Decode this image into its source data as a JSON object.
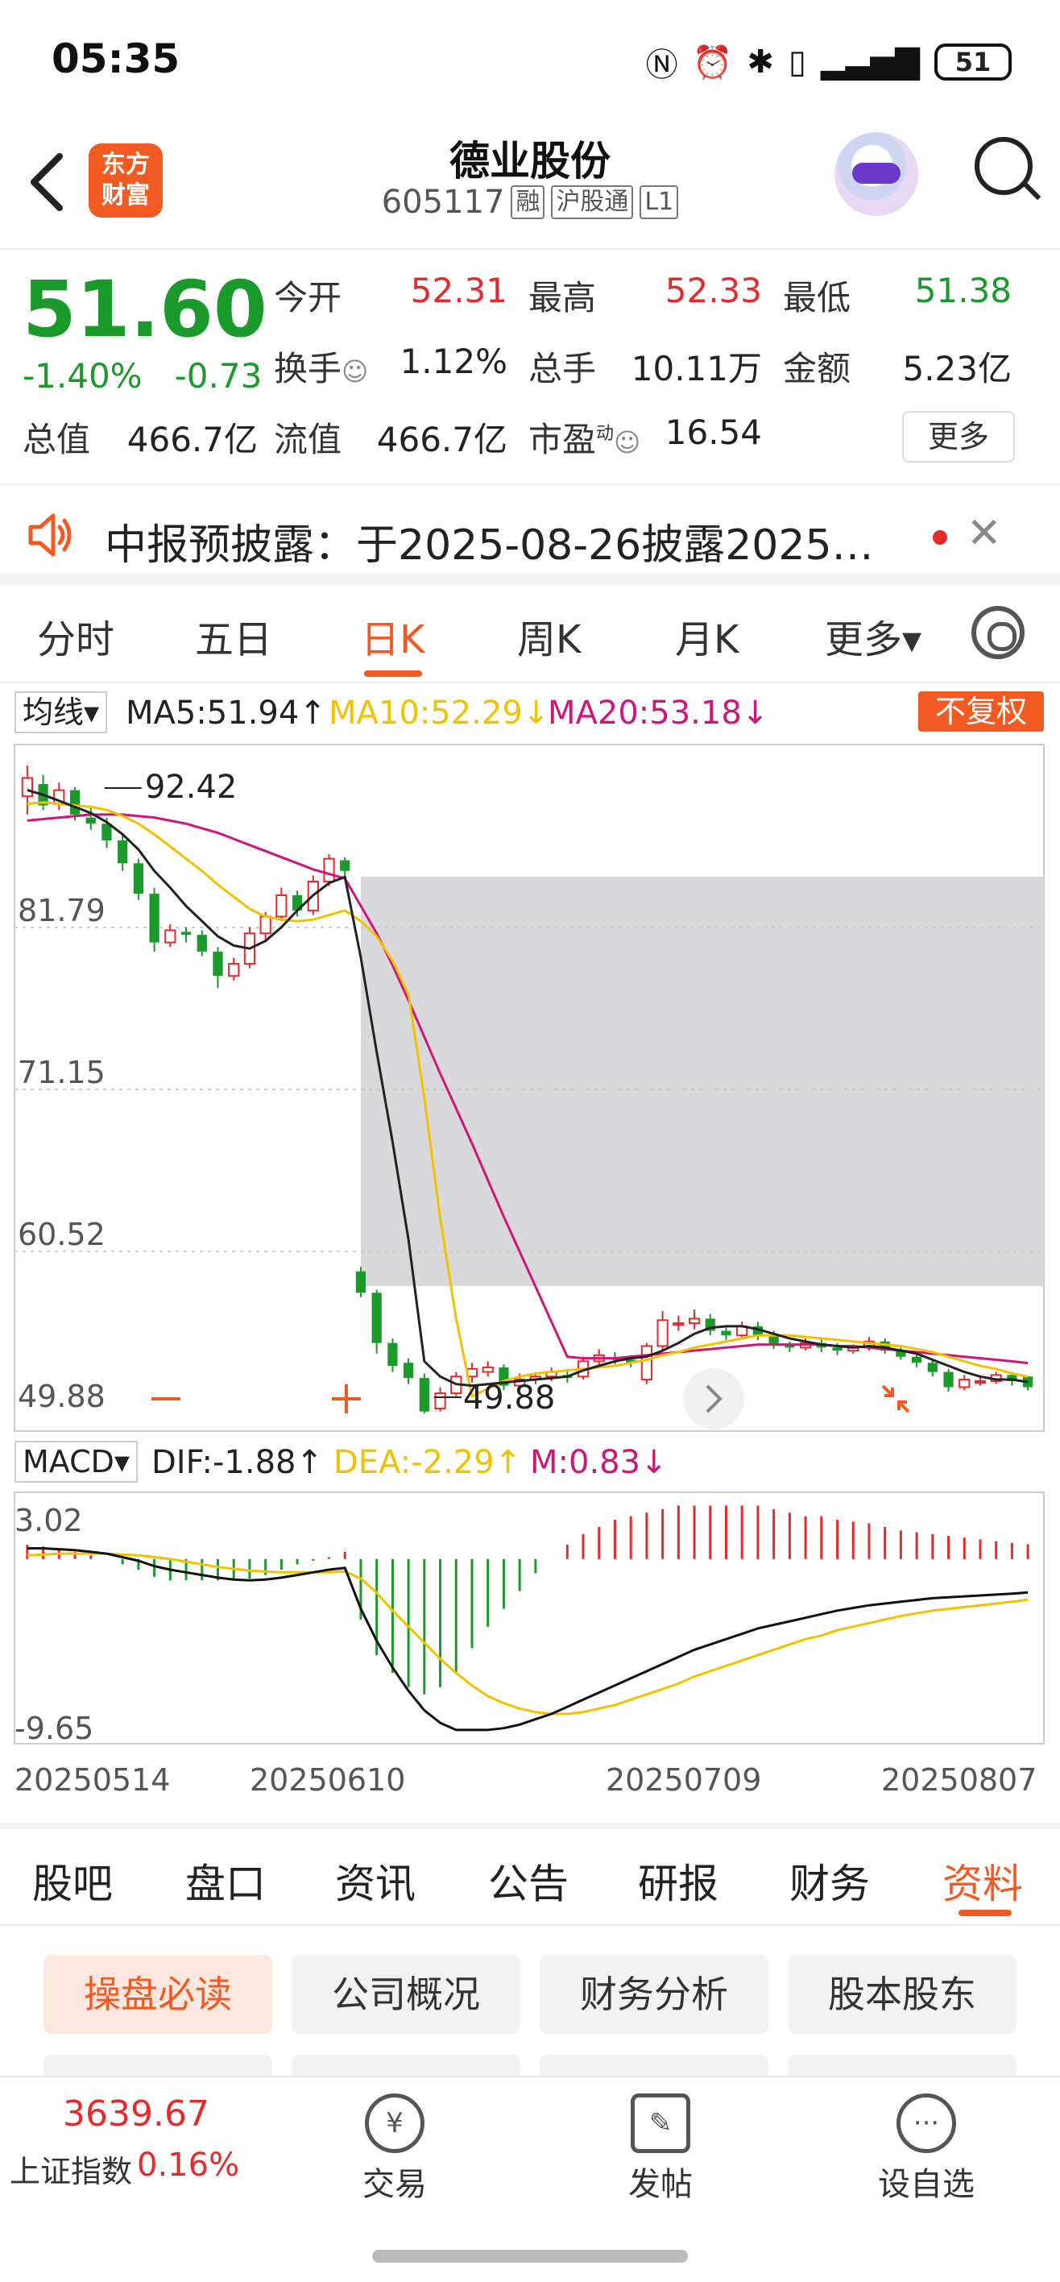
{
  "status_bar": {
    "time": "05:35",
    "battery": "51"
  },
  "header": {
    "back_icon": "chevron-left-icon",
    "logo_text": [
      "东方",
      "财富"
    ],
    "stock_name": "德业股份",
    "stock_code": "605117",
    "tags": [
      "融",
      "沪股通",
      "L1"
    ]
  },
  "quote": {
    "price": "51.60",
    "change_pct": "-1.40%",
    "change_abs": "-0.73",
    "open_label": "今开",
    "open": "52.31",
    "high_label": "最高",
    "high": "52.33",
    "low_label": "最低",
    "low": "51.38",
    "turnover_label": "换手",
    "turnover": "1.12%",
    "volume_label": "总手",
    "volume": "10.11万",
    "amount_label": "金额",
    "amount": "5.23亿",
    "mktcap_label": "总值",
    "mktcap": "466.7亿",
    "float_label": "流值",
    "float": "466.7亿",
    "pe_label": "市盈",
    "pe_sup": "动",
    "pe": "16.54",
    "more_button": "更多",
    "colors": {
      "up": "#e42a2a",
      "down": "#1a9a2a"
    }
  },
  "notice": {
    "text": "中报预披露：于2025-08-26披露2025…"
  },
  "chart_tabs": [
    "分时",
    "五日",
    "日K",
    "周K",
    "月K",
    "更多▾"
  ],
  "ma_row": {
    "select": "均线▾",
    "ma5": "MA5:51.94↑",
    "ma10": "MA10:52.29↓",
    "ma20": "MA20:53.18↓",
    "fq_button": "不复权"
  },
  "macd_row": {
    "select": "MACD▾",
    "dif": "DIF:-1.88↑",
    "dea": "DEA:-2.29↑",
    "m": "M:0.83↓"
  },
  "chart_data": [
    {
      "type": "candlestick",
      "y_axis_labels": [
        "81.79",
        "71.15",
        "60.52",
        "49.88"
      ],
      "ylim": [
        49.88,
        92.42
      ],
      "max_marker": "92.42",
      "min_marker": "49.88",
      "candles": [
        [
          90.4,
          91.6,
          89.2,
          92.42
        ],
        [
          91.2,
          89.8,
          89.5,
          91.8
        ],
        [
          89.9,
          90.8,
          89.5,
          91.3
        ],
        [
          90.8,
          89.2,
          88.8,
          91.0
        ],
        [
          89.0,
          88.6,
          88.2,
          89.8
        ],
        [
          88.6,
          87.5,
          87.0,
          89.0
        ],
        [
          87.5,
          86.0,
          85.5,
          88.0
        ],
        [
          86.0,
          84.0,
          83.6,
          86.3
        ],
        [
          84.0,
          80.8,
          80.2,
          84.4
        ],
        [
          80.8,
          81.6,
          80.5,
          82.0
        ],
        [
          81.5,
          81.3,
          80.8,
          81.8
        ],
        [
          81.3,
          80.2,
          79.9,
          81.6
        ],
        [
          80.2,
          78.6,
          77.8,
          80.5
        ],
        [
          78.6,
          79.4,
          78.3,
          79.8
        ],
        [
          79.4,
          81.4,
          79.1,
          81.8
        ],
        [
          81.4,
          82.5,
          81.0,
          82.8
        ],
        [
          82.5,
          83.9,
          82.2,
          84.4
        ],
        [
          83.9,
          82.9,
          82.5,
          84.2
        ],
        [
          82.9,
          84.8,
          82.6,
          85.2
        ],
        [
          84.8,
          86.3,
          84.5,
          86.6
        ],
        [
          86.2,
          85.5,
          85.0,
          86.4
        ],
        [
          59.2,
          57.8,
          57.5,
          59.5
        ],
        [
          57.8,
          54.5,
          53.8,
          58.0
        ],
        [
          54.5,
          53.0,
          52.6,
          54.8
        ],
        [
          53.2,
          52.2,
          51.8,
          53.5
        ],
        [
          52.2,
          50.0,
          49.88,
          52.5
        ],
        [
          50.2,
          51.2,
          50.0,
          51.6
        ],
        [
          51.2,
          52.3,
          51.0,
          52.6
        ],
        [
          52.3,
          52.8,
          51.9,
          53.2
        ],
        [
          52.6,
          52.9,
          52.3,
          53.3
        ],
        [
          52.9,
          51.7,
          51.4,
          53.1
        ],
        [
          51.7,
          52.1,
          51.5,
          52.5
        ],
        [
          52.1,
          52.3,
          51.8,
          52.6
        ],
        [
          52.3,
          52.6,
          52.0,
          52.9
        ],
        [
          52.4,
          52.2,
          51.9,
          52.8
        ],
        [
          52.3,
          53.3,
          52.1,
          53.6
        ],
        [
          53.3,
          53.7,
          53.0,
          54.1
        ],
        [
          53.5,
          53.4,
          53.1,
          53.9
        ],
        [
          53.4,
          53.2,
          52.9,
          53.7
        ],
        [
          52.1,
          54.3,
          51.8,
          54.5
        ],
        [
          54.3,
          56.0,
          54.0,
          56.6
        ],
        [
          55.7,
          55.8,
          55.3,
          56.3
        ],
        [
          55.8,
          56.1,
          55.4,
          56.7
        ],
        [
          56.1,
          55.3,
          55.0,
          56.4
        ],
        [
          55.3,
          55.0,
          54.7,
          55.6
        ],
        [
          55.0,
          55.6,
          54.8,
          55.9
        ],
        [
          55.6,
          55.0,
          54.7,
          55.9
        ],
        [
          55.0,
          54.4,
          54.1,
          55.3
        ],
        [
          54.4,
          54.2,
          53.9,
          54.6
        ],
        [
          54.2,
          54.5,
          54.0,
          54.8
        ],
        [
          54.5,
          54.2,
          53.9,
          54.8
        ],
        [
          54.2,
          54.0,
          53.7,
          54.5
        ],
        [
          54.0,
          54.2,
          53.8,
          54.4
        ],
        [
          54.2,
          54.6,
          54.0,
          54.9
        ],
        [
          54.6,
          54.0,
          53.8,
          54.8
        ],
        [
          54.0,
          53.6,
          53.4,
          54.2
        ],
        [
          53.6,
          53.2,
          52.9,
          53.9
        ],
        [
          53.2,
          52.6,
          52.3,
          53.4
        ],
        [
          52.6,
          51.6,
          51.3,
          52.8
        ],
        [
          51.6,
          52.1,
          51.4,
          52.4
        ],
        [
          52.0,
          52.0,
          51.7,
          52.3
        ],
        [
          52.0,
          52.4,
          51.8,
          52.6
        ],
        [
          52.4,
          52.0,
          51.7,
          52.6
        ],
        [
          52.3,
          51.6,
          51.38,
          52.33
        ]
      ],
      "ma5": [
        90.8,
        90.5,
        90.1,
        89.7,
        89.3,
        88.7,
        87.9,
        86.9,
        85.5,
        84.4,
        83.2,
        82.2,
        81.2,
        80.6,
        80.4,
        80.9,
        81.8,
        82.9,
        83.9,
        84.7,
        85.1,
        79.8,
        73.6,
        67.7,
        61.3,
        53.3,
        52.3,
        51.8,
        51.7,
        51.8,
        51.9,
        52.0,
        52.1,
        52.2,
        52.3,
        52.7,
        53.0,
        53.3,
        53.5,
        53.6,
        54.0,
        54.5,
        55.1,
        55.5,
        55.6,
        55.6,
        55.4,
        55.1,
        54.8,
        54.6,
        54.4,
        54.3,
        54.2,
        54.3,
        54.2,
        54.0,
        53.8,
        53.4,
        53.0,
        52.6,
        52.3,
        52.1,
        52.1,
        51.94
      ],
      "ma10": [
        89.9,
        90.0,
        89.9,
        89.8,
        89.7,
        89.5,
        89.1,
        88.6,
        87.9,
        87.1,
        86.3,
        85.5,
        84.6,
        83.8,
        83.0,
        82.5,
        82.3,
        82.2,
        82.3,
        82.6,
        82.9,
        82.2,
        81.2,
        79.6,
        77.4,
        70.6,
        62.7,
        56.1,
        51.0,
        51.5,
        52.0,
        52.3,
        52.5,
        52.6,
        52.7,
        52.8,
        52.9,
        53.0,
        53.2,
        53.4,
        53.7,
        53.9,
        54.2,
        54.4,
        54.6,
        54.8,
        55.0,
        55.0,
        55.0,
        54.9,
        54.8,
        54.7,
        54.6,
        54.5,
        54.4,
        54.3,
        54.1,
        53.9,
        53.6,
        53.3,
        53.0,
        52.8,
        52.5,
        52.29
      ],
      "ma20": [
        88.8,
        88.9,
        89.0,
        89.1,
        89.2,
        89.2,
        89.2,
        89.1,
        89.0,
        88.8,
        88.6,
        88.3,
        88.0,
        87.6,
        87.2,
        86.8,
        86.4,
        86.0,
        85.6,
        85.3,
        85.0,
        83.2,
        81.4,
        79.3,
        77.0,
        74.6,
        72.2,
        69.9,
        67.6,
        65.2,
        62.8,
        60.5,
        58.2,
        55.9,
        53.6,
        53.5,
        53.5,
        53.5,
        53.6,
        53.7,
        53.8,
        53.9,
        54.0,
        54.1,
        54.2,
        54.3,
        54.4,
        54.4,
        54.4,
        54.4,
        54.4,
        54.3,
        54.3,
        54.2,
        54.1,
        54.0,
        53.9,
        53.8,
        53.7,
        53.6,
        53.5,
        53.4,
        53.3,
        53.18
      ],
      "ma_names": [
        "MA5",
        "MA10",
        "MA20"
      ],
      "ma_colors": [
        "#222222",
        "#f2c200",
        "#d0157a"
      ]
    },
    {
      "type": "macd",
      "y_axis_labels": [
        "3.02",
        "-9.65"
      ],
      "ylim": [
        -9.65,
        3.02
      ],
      "x_labels": [
        "20250514",
        "20250610",
        "20250709",
        "20250807"
      ],
      "dif": [
        0.6,
        0.6,
        0.55,
        0.5,
        0.4,
        0.3,
        0.1,
        -0.1,
        -0.4,
        -0.6,
        -0.75,
        -0.9,
        -1.05,
        -1.15,
        -1.2,
        -1.15,
        -1.05,
        -0.9,
        -0.75,
        -0.6,
        -0.5,
        -2.8,
        -4.6,
        -6.1,
        -7.4,
        -8.5,
        -9.2,
        -9.6,
        -9.6,
        -9.6,
        -9.5,
        -9.3,
        -9.0,
        -8.7,
        -8.3,
        -7.9,
        -7.5,
        -7.1,
        -6.7,
        -6.3,
        -5.9,
        -5.5,
        -5.1,
        -4.8,
        -4.5,
        -4.2,
        -3.9,
        -3.7,
        -3.5,
        -3.3,
        -3.1,
        -2.9,
        -2.75,
        -2.6,
        -2.5,
        -2.4,
        -2.3,
        -2.2,
        -2.15,
        -2.1,
        -2.05,
        -2.0,
        -1.95,
        -1.88
      ],
      "dea": [
        0.2,
        0.25,
        0.3,
        0.3,
        0.3,
        0.3,
        0.25,
        0.2,
        0.1,
        0.0,
        -0.15,
        -0.3,
        -0.45,
        -0.55,
        -0.65,
        -0.7,
        -0.75,
        -0.75,
        -0.75,
        -0.75,
        -0.7,
        -1.1,
        -1.9,
        -2.9,
        -3.8,
        -4.7,
        -5.6,
        -6.4,
        -7.1,
        -7.7,
        -8.1,
        -8.4,
        -8.6,
        -8.7,
        -8.7,
        -8.6,
        -8.4,
        -8.2,
        -7.9,
        -7.6,
        -7.3,
        -7.0,
        -6.6,
        -6.3,
        -6.0,
        -5.7,
        -5.4,
        -5.1,
        -4.8,
        -4.5,
        -4.3,
        -4.0,
        -3.8,
        -3.6,
        -3.4,
        -3.2,
        -3.05,
        -2.9,
        -2.8,
        -2.7,
        -2.6,
        -2.5,
        -2.4,
        -2.29
      ],
      "m": [
        0.8,
        0.7,
        0.5,
        0.4,
        0.2,
        0.0,
        -0.3,
        -0.6,
        -1.0,
        -1.2,
        -1.2,
        -1.2,
        -1.2,
        -1.2,
        -1.1,
        -0.9,
        -0.6,
        -0.3,
        -0.1,
        0.1,
        0.4,
        -3.4,
        -5.4,
        -6.4,
        -7.2,
        -7.6,
        -7.2,
        -6.4,
        -5.0,
        -3.8,
        -2.8,
        -1.8,
        -0.8,
        0.0,
        0.8,
        1.4,
        1.8,
        2.2,
        2.4,
        2.6,
        2.8,
        3.0,
        3.0,
        3.0,
        3.0,
        3.0,
        3.0,
        2.8,
        2.6,
        2.4,
        2.4,
        2.2,
        2.1,
        2.0,
        1.8,
        1.6,
        1.5,
        1.4,
        1.3,
        1.2,
        1.1,
        1.0,
        0.9,
        0.83
      ],
      "line_colors": {
        "dif": "#111111",
        "dea": "#f2c200"
      }
    }
  ],
  "section_tabs": [
    "股吧",
    "盘口",
    "资讯",
    "公告",
    "研报",
    "财务",
    "资料"
  ],
  "sub_buttons": [
    "操盘必读",
    "公司概况",
    "财务分析",
    "股本股东"
  ],
  "bottom_bar": {
    "index_value": "3639.67",
    "index_name": "上证指数",
    "index_change": "0.16%",
    "trade_label": "交易",
    "trade_icon": "¥",
    "post_label": "发帖",
    "watch_label": "设自选"
  }
}
